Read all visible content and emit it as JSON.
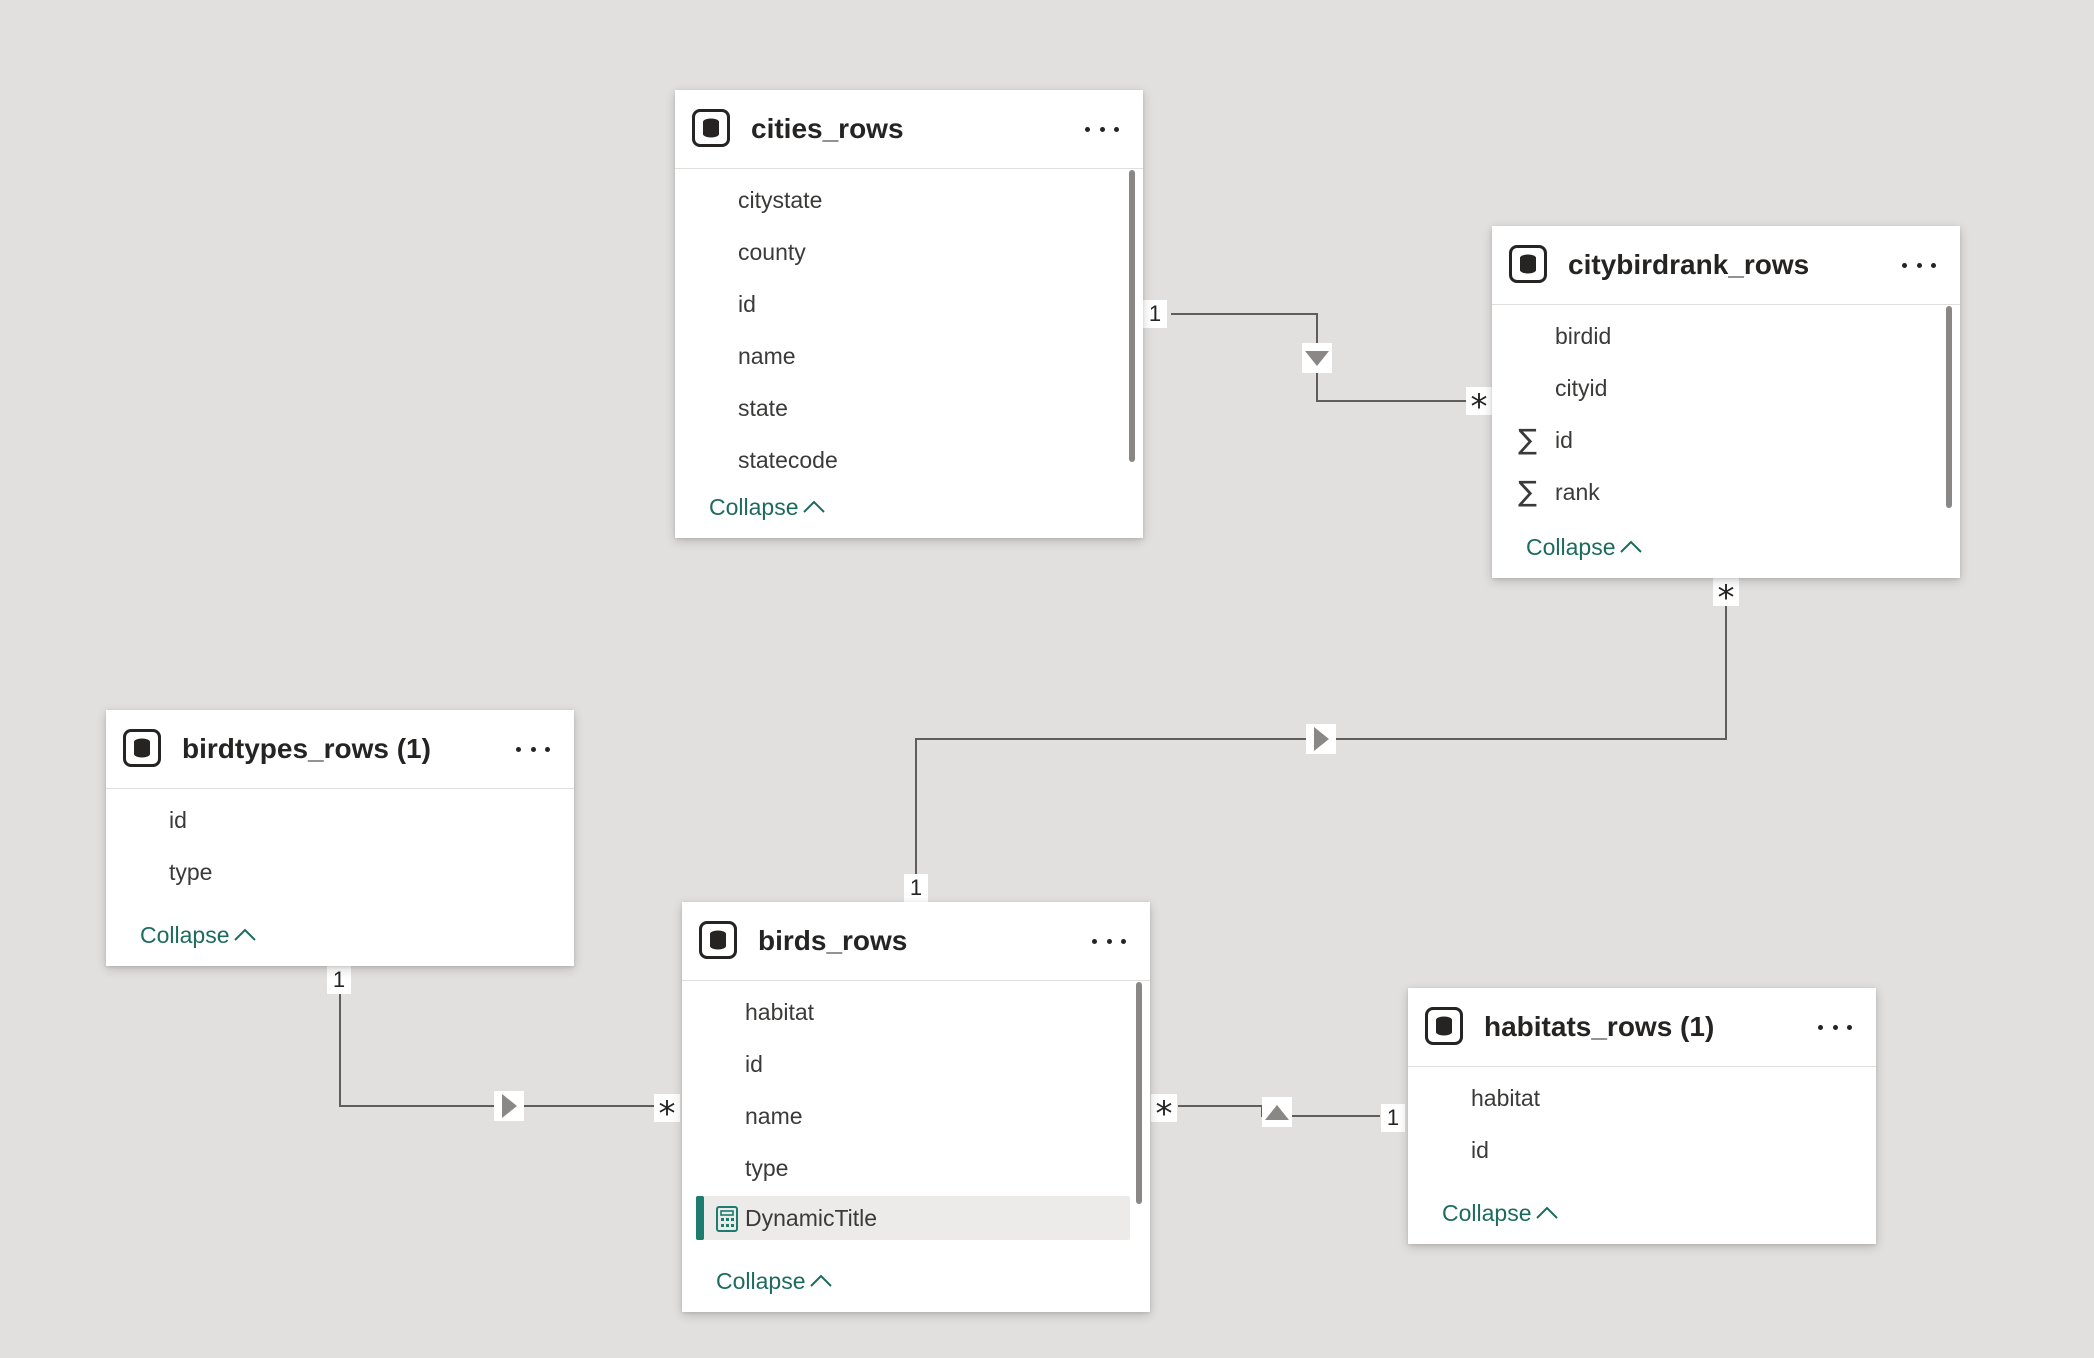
{
  "tables": {
    "cities_rows": {
      "title": "cities_rows",
      "fields": [
        "citystate",
        "county",
        "id",
        "name",
        "state",
        "statecode"
      ],
      "collapse_label": "Collapse"
    },
    "citybirdrank_rows": {
      "title": "citybirdrank_rows",
      "fields": [
        "birdid",
        "cityid",
        "id",
        "rank"
      ],
      "collapse_label": "Collapse"
    },
    "birdtypes_rows": {
      "title": "birdtypes_rows (1)",
      "fields": [
        "id",
        "type"
      ],
      "collapse_label": "Collapse"
    },
    "birds_rows": {
      "title": "birds_rows",
      "fields": [
        "habitat",
        "id",
        "name",
        "type",
        "DynamicTitle"
      ],
      "collapse_label": "Collapse"
    },
    "habitats_rows": {
      "title": "habitats_rows (1)",
      "fields": [
        "habitat",
        "id"
      ],
      "collapse_label": "Collapse"
    }
  },
  "relationships": {
    "cities_citybirdrank": {
      "from_card": "1",
      "to_card": "*"
    },
    "birds_citybirdrank": {
      "from_card": "1",
      "to_card": "*"
    },
    "birdtypes_birds": {
      "from_card": "1",
      "to_card": "*"
    },
    "habitats_birds": {
      "from_card": "1",
      "to_card": "*"
    }
  },
  "colors": {
    "canvas": "#e2e0de",
    "accent": "#1c7d6e",
    "link": "#1d6b5e",
    "line": "#605e5c"
  },
  "icons": {
    "table": "table-icon",
    "more": "more-options-icon",
    "sum": "sigma-icon",
    "measure": "calculator-icon",
    "collapse": "chevron-up-icon",
    "filter_direction": "filter-direction-arrow-icon"
  }
}
